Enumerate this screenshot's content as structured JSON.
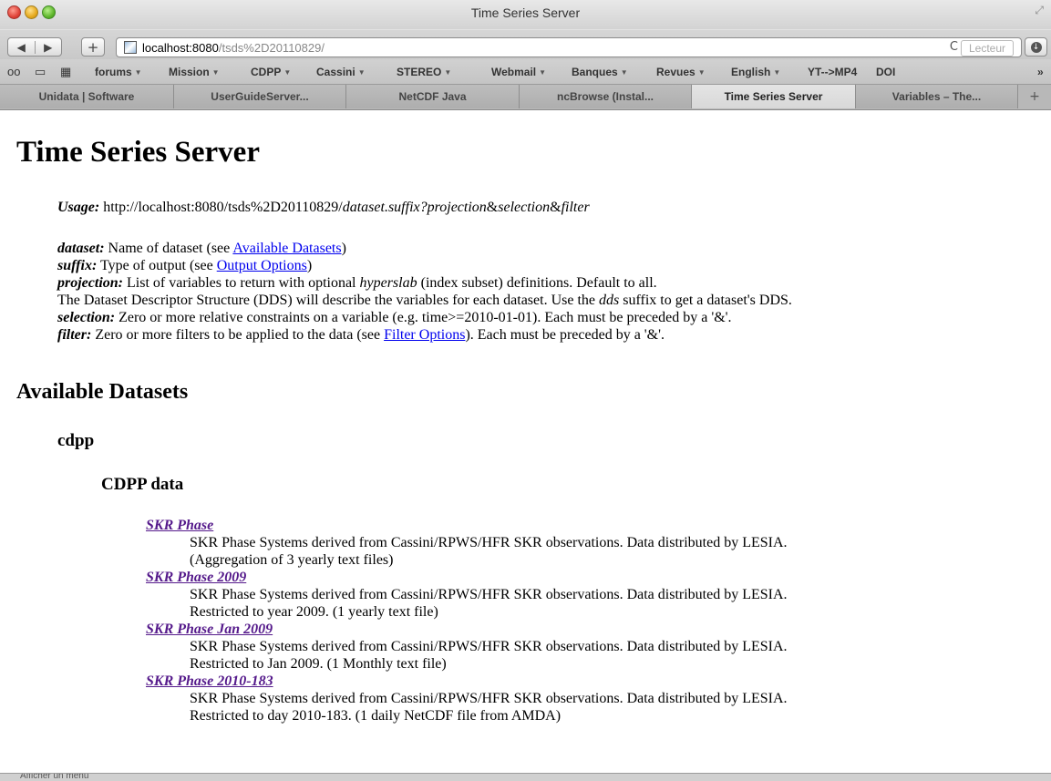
{
  "window": {
    "title": "Time Series Server"
  },
  "toolbar": {
    "back": "◀",
    "forward": "▶",
    "add": "+",
    "url_host": "localhost:8080",
    "url_path": "/tsds%2D20110829/",
    "reload": "C",
    "reader": "Lecteur"
  },
  "bookmarks": [
    {
      "label": "forums",
      "menu": true
    },
    {
      "label": "Mission",
      "menu": true
    },
    {
      "label": "CDPP",
      "menu": true
    },
    {
      "label": "Cassini",
      "menu": true
    },
    {
      "label": "STEREO",
      "menu": true
    },
    {
      "label": "Webmail",
      "menu": true
    },
    {
      "label": "Banques",
      "menu": true
    },
    {
      "label": "Revues",
      "menu": true
    },
    {
      "label": "English",
      "menu": true
    },
    {
      "label": "YT-->MP4",
      "menu": false
    },
    {
      "label": "DOI",
      "menu": false
    }
  ],
  "tabs": [
    {
      "label": "Unidata | Software",
      "active": false
    },
    {
      "label": "UserGuideServer...",
      "active": false
    },
    {
      "label": "NetCDF Java",
      "active": false
    },
    {
      "label": "ncBrowse (Instal...",
      "active": false
    },
    {
      "label": "Time Series Server",
      "active": true
    },
    {
      "label": "Variables – The...",
      "active": false
    }
  ],
  "page": {
    "title": "Time Series Server",
    "usage": {
      "label": "Usage:",
      "url": "http://localhost:8080/tsds%2D20110829/",
      "dataset_suffix": "dataset.suffix",
      "q": "?",
      "projection": "projection",
      "amp1": "&",
      "selection": "selection",
      "amp2": "&",
      "filter": "filter"
    },
    "defs": {
      "dataset_label": "dataset:",
      "dataset_text1": "Name of dataset (see ",
      "dataset_link": "Available Datasets",
      "dataset_text2": ")",
      "suffix_label": "suffix:",
      "suffix_text1": "Type of output (see ",
      "suffix_link": "Output Options",
      "suffix_text2": ")",
      "projection_label": "projection:",
      "projection_text1": "List of variables to return with optional ",
      "projection_em": "hyperslab",
      "projection_text2": " (index subset) definitions. Default to all.",
      "dds_text1": "The Dataset Descriptor Structure (DDS) will describe the variables for each dataset. Use the ",
      "dds_em": "dds",
      "dds_text2": " suffix to get a dataset's DDS.",
      "selection_label": "selection:",
      "selection_text": "Zero or more relative constraints on a variable (e.g. time>=2010-01-01). Each must be preceded by a '&'.",
      "filter_label": "filter:",
      "filter_text1": "Zero or more filters to be applied to the data (see ",
      "filter_link": "Filter Options",
      "filter_text2": "). Each must be preceded by a '&'."
    },
    "available_heading": "Available Datasets",
    "group_name": "cdpp",
    "group_title": "CDPP data",
    "datasets": [
      {
        "name": "SKR Phase",
        "desc1": "SKR Phase Systems derived from Cassini/RPWS/HFR SKR observations. Data distributed by LESIA.",
        "desc2": "(Aggregation of 3 yearly text files)"
      },
      {
        "name": "SKR Phase 2009",
        "desc1": "SKR Phase Systems derived from Cassini/RPWS/HFR SKR observations. Data distributed by LESIA.",
        "desc2": "Restricted to year 2009. (1 yearly text file)"
      },
      {
        "name": "SKR Phase Jan 2009",
        "desc1": "SKR Phase Systems derived from Cassini/RPWS/HFR SKR observations. Data distributed by LESIA.",
        "desc2": "Restricted to Jan 2009. (1 Monthly text file)"
      },
      {
        "name": "SKR Phase 2010-183",
        "desc1": "SKR Phase Systems derived from Cassini/RPWS/HFR SKR observations. Data distributed by LESIA.",
        "desc2": "Restricted to day 2010-183. (1 daily NetCDF file from AMDA)"
      }
    ]
  },
  "status": {
    "text": "Afficher un menu"
  }
}
